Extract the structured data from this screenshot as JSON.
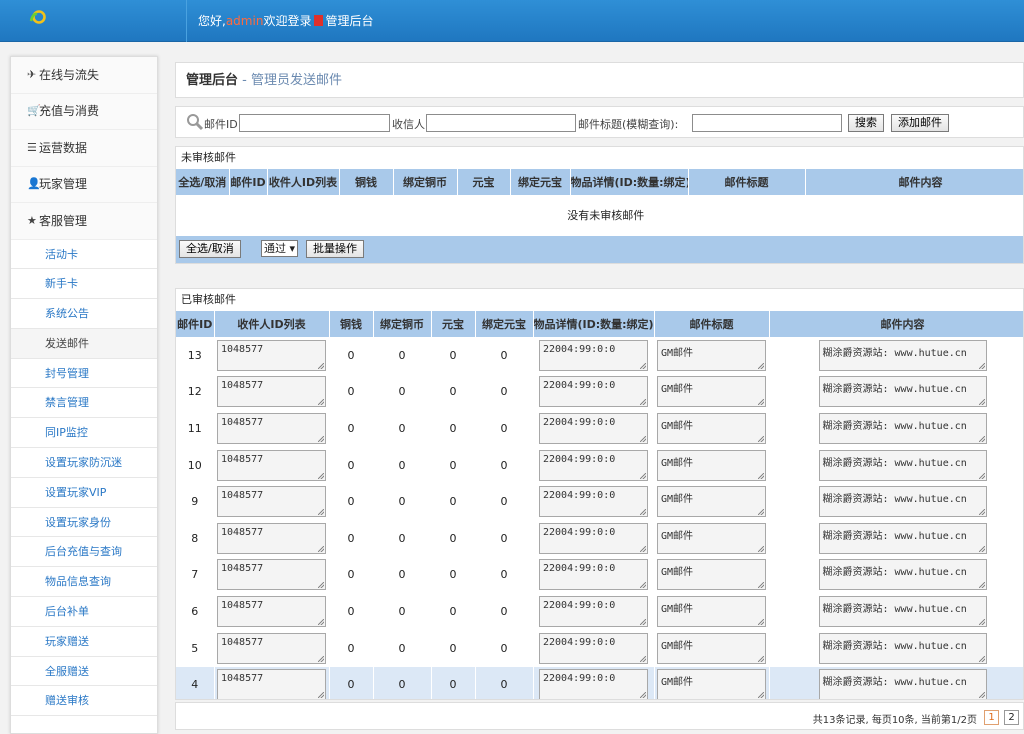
{
  "header": {
    "greeting_prefix": "您好,",
    "username": "admin",
    "welcome_text": "欢迎登录",
    "admin_label": "管理后台"
  },
  "sidebar": {
    "menus": [
      {
        "label": "在线与流失",
        "icon": "plane-icon"
      },
      {
        "label": "充值与消费",
        "icon": "cart-icon"
      },
      {
        "label": "运营数据",
        "icon": "list-icon"
      },
      {
        "label": "玩家管理",
        "icon": "user-icon"
      },
      {
        "label": "客服管理",
        "icon": "star-icon"
      }
    ],
    "items": [
      "活动卡",
      "新手卡",
      "系统公告",
      "发送邮件",
      "封号管理",
      "禁言管理",
      "同IP监控",
      "设置玩家防沉迷",
      "设置玩家VIP",
      "设置玩家身份",
      "后台充值与查询",
      "物品信息查询",
      "后台补单",
      "玩家赠送",
      "全服赠送",
      "赠送审核"
    ],
    "selected_item": "发送邮件"
  },
  "breadcrumb": {
    "title": "管理后台",
    "separator": " - ",
    "subtitle": "管理员发送邮件"
  },
  "search": {
    "mail_id_label": "邮件ID:",
    "mail_id_value": "",
    "recipient_label": "收信人:",
    "recipient_value": "",
    "mail_title_label": "邮件标题(模糊查询):",
    "mail_title_value": "",
    "search_button": "搜索",
    "add_button": "添加邮件"
  },
  "pending": {
    "title": "未审核邮件",
    "columns": [
      "全选/取消",
      "邮件ID",
      "收件人ID列表",
      "铜钱",
      "绑定铜币",
      "元宝",
      "绑定元宝",
      "物品详情(ID:数量:绑定)",
      "邮件标题",
      "邮件内容"
    ],
    "empty_text": "没有未审核邮件",
    "select_all_button": "全选/取消",
    "action_select": "通过",
    "batch_button": "批量操作"
  },
  "approved": {
    "title": "已审核邮件",
    "columns": [
      "邮件ID",
      "收件人ID列表",
      "铜钱",
      "绑定铜币",
      "元宝",
      "绑定元宝",
      "物品详情(ID:数量:绑定)",
      "邮件标题",
      "邮件内容"
    ],
    "rows": [
      {
        "id": "13",
        "recipients": "1048577",
        "copper": "0",
        "bound_copper": "0",
        "ingot": "0",
        "bound_ingot": "0",
        "items": "22004:99:0:0",
        "mail_title": "GM邮件",
        "content": "糊涂爵资源站: www.hutue.cn"
      },
      {
        "id": "12",
        "recipients": "1048577",
        "copper": "0",
        "bound_copper": "0",
        "ingot": "0",
        "bound_ingot": "0",
        "items": "22004:99:0:0",
        "mail_title": "GM邮件",
        "content": "糊涂爵资源站: www.hutue.cn"
      },
      {
        "id": "11",
        "recipients": "1048577",
        "copper": "0",
        "bound_copper": "0",
        "ingot": "0",
        "bound_ingot": "0",
        "items": "22004:99:0:0",
        "mail_title": "GM邮件",
        "content": "糊涂爵资源站: www.hutue.cn"
      },
      {
        "id": "10",
        "recipients": "1048577",
        "copper": "0",
        "bound_copper": "0",
        "ingot": "0",
        "bound_ingot": "0",
        "items": "22004:99:0:0",
        "mail_title": "GM邮件",
        "content": "糊涂爵资源站: www.hutue.cn"
      },
      {
        "id": "9",
        "recipients": "1048577",
        "copper": "0",
        "bound_copper": "0",
        "ingot": "0",
        "bound_ingot": "0",
        "items": "22004:99:0:0",
        "mail_title": "GM邮件",
        "content": "糊涂爵资源站: www.hutue.cn"
      },
      {
        "id": "8",
        "recipients": "1048577",
        "copper": "0",
        "bound_copper": "0",
        "ingot": "0",
        "bound_ingot": "0",
        "items": "22004:99:0:0",
        "mail_title": "GM邮件",
        "content": "糊涂爵资源站: www.hutue.cn"
      },
      {
        "id": "7",
        "recipients": "1048577",
        "copper": "0",
        "bound_copper": "0",
        "ingot": "0",
        "bound_ingot": "0",
        "items": "22004:99:0:0",
        "mail_title": "GM邮件",
        "content": "糊涂爵资源站: www.hutue.cn"
      },
      {
        "id": "6",
        "recipients": "1048577",
        "copper": "0",
        "bound_copper": "0",
        "ingot": "0",
        "bound_ingot": "0",
        "items": "22004:99:0:0",
        "mail_title": "GM邮件",
        "content": "糊涂爵资源站: www.hutue.cn"
      },
      {
        "id": "5",
        "recipients": "1048577",
        "copper": "0",
        "bound_copper": "0",
        "ingot": "0",
        "bound_ingot": "0",
        "items": "22004:99:0:0",
        "mail_title": "GM邮件",
        "content": "糊涂爵资源站: www.hutue.cn"
      },
      {
        "id": "4",
        "recipients": "1048577",
        "copper": "0",
        "bound_copper": "0",
        "ingot": "0",
        "bound_ingot": "0",
        "items": "22004:99:0:0",
        "mail_title": "GM邮件",
        "content": "糊涂爵资源站: www.hutue.cn"
      }
    ]
  },
  "pagination": {
    "summary": "共13条记录, 每页10条, 当前第1/2页",
    "pages": [
      "1",
      "2"
    ],
    "current_page": "1"
  },
  "colors": {
    "header_bg": "#2586cf",
    "table_header_bg": "#a9c9ea",
    "link": "#2a78c6",
    "username": "#ff6a3d"
  }
}
